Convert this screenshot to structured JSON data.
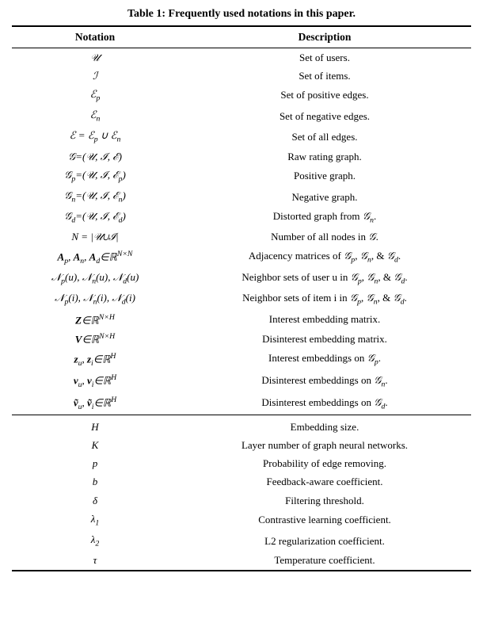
{
  "title": "Table 1: Frequently used notations in this paper.",
  "columns": [
    "Notation",
    "Description"
  ],
  "section1": [
    {
      "notation": "𝒰",
      "description": "Set of users."
    },
    {
      "notation": "ℐ",
      "description": "Set of items."
    },
    {
      "notation": "ℰ_p",
      "description": "Set of positive edges."
    },
    {
      "notation": "ℰ_n",
      "description": "Set of negative edges."
    },
    {
      "notation": "ℰ = ℰ_p ∪ ℰ_n",
      "description": "Set of all edges."
    },
    {
      "notation": "𝒢=(𝒰, ℐ, ℰ)",
      "description": "Raw rating graph."
    },
    {
      "notation": "𝒢_p=(𝒰, ℐ, ℰ_p)",
      "description": "Positive graph."
    },
    {
      "notation": "𝒢_n=(𝒰, ℐ, ℰ_n)",
      "description": "Negative graph."
    },
    {
      "notation": "𝒢_d=(𝒰, ℐ, ℰ_d)",
      "description": "Distorted graph from 𝒢_n."
    },
    {
      "notation": "N = |𝒰∪ℐ|",
      "description": "Number of all nodes in 𝒢."
    },
    {
      "notation": "A_p, A_n, A_d ∈ ℝ^{N×N}",
      "description": "Adjacency matrices of 𝒢_p, 𝒢_n, & 𝒢_d."
    },
    {
      "notation": "𝒩_p(u), 𝒩_n(u), 𝒩_d(u)",
      "description": "Neighbor sets of user u in 𝒢_p, 𝒢_n, & 𝒢_d."
    },
    {
      "notation": "𝒩_p(i), 𝒩_n(i), 𝒩_d(i)",
      "description": "Neighbor sets of item i in 𝒢_p, 𝒢_n, & 𝒢_d."
    },
    {
      "notation": "Z∈ℝ^{N×H}",
      "description": "Interest embedding matrix."
    },
    {
      "notation": "V∈ℝ^{N×H}",
      "description": "Disinterest embedding matrix."
    },
    {
      "notation": "z_u, z_i∈ℝ^H",
      "description": "Interest embeddings on 𝒢_p."
    },
    {
      "notation": "v_u, v_i∈ℝ^H",
      "description": "Disinterest embeddings on 𝒢_n."
    },
    {
      "notation": "ṽ_u, ṽ_i∈ℝ^H",
      "description": "Disinterest embeddings on 𝒢_d."
    }
  ],
  "section2": [
    {
      "notation": "H",
      "description": "Embedding size."
    },
    {
      "notation": "K",
      "description": "Layer number of graph neural networks."
    },
    {
      "notation": "p",
      "description": "Probability of edge removing."
    },
    {
      "notation": "b",
      "description": "Feedback-aware coefficient."
    },
    {
      "notation": "δ",
      "description": "Filtering threshold."
    },
    {
      "notation": "λ₁",
      "description": "Contrastive learning coefficient."
    },
    {
      "notation": "λ₂",
      "description": "L2 regularization coefficient."
    },
    {
      "notation": "τ",
      "description": "Temperature coefficient."
    }
  ]
}
